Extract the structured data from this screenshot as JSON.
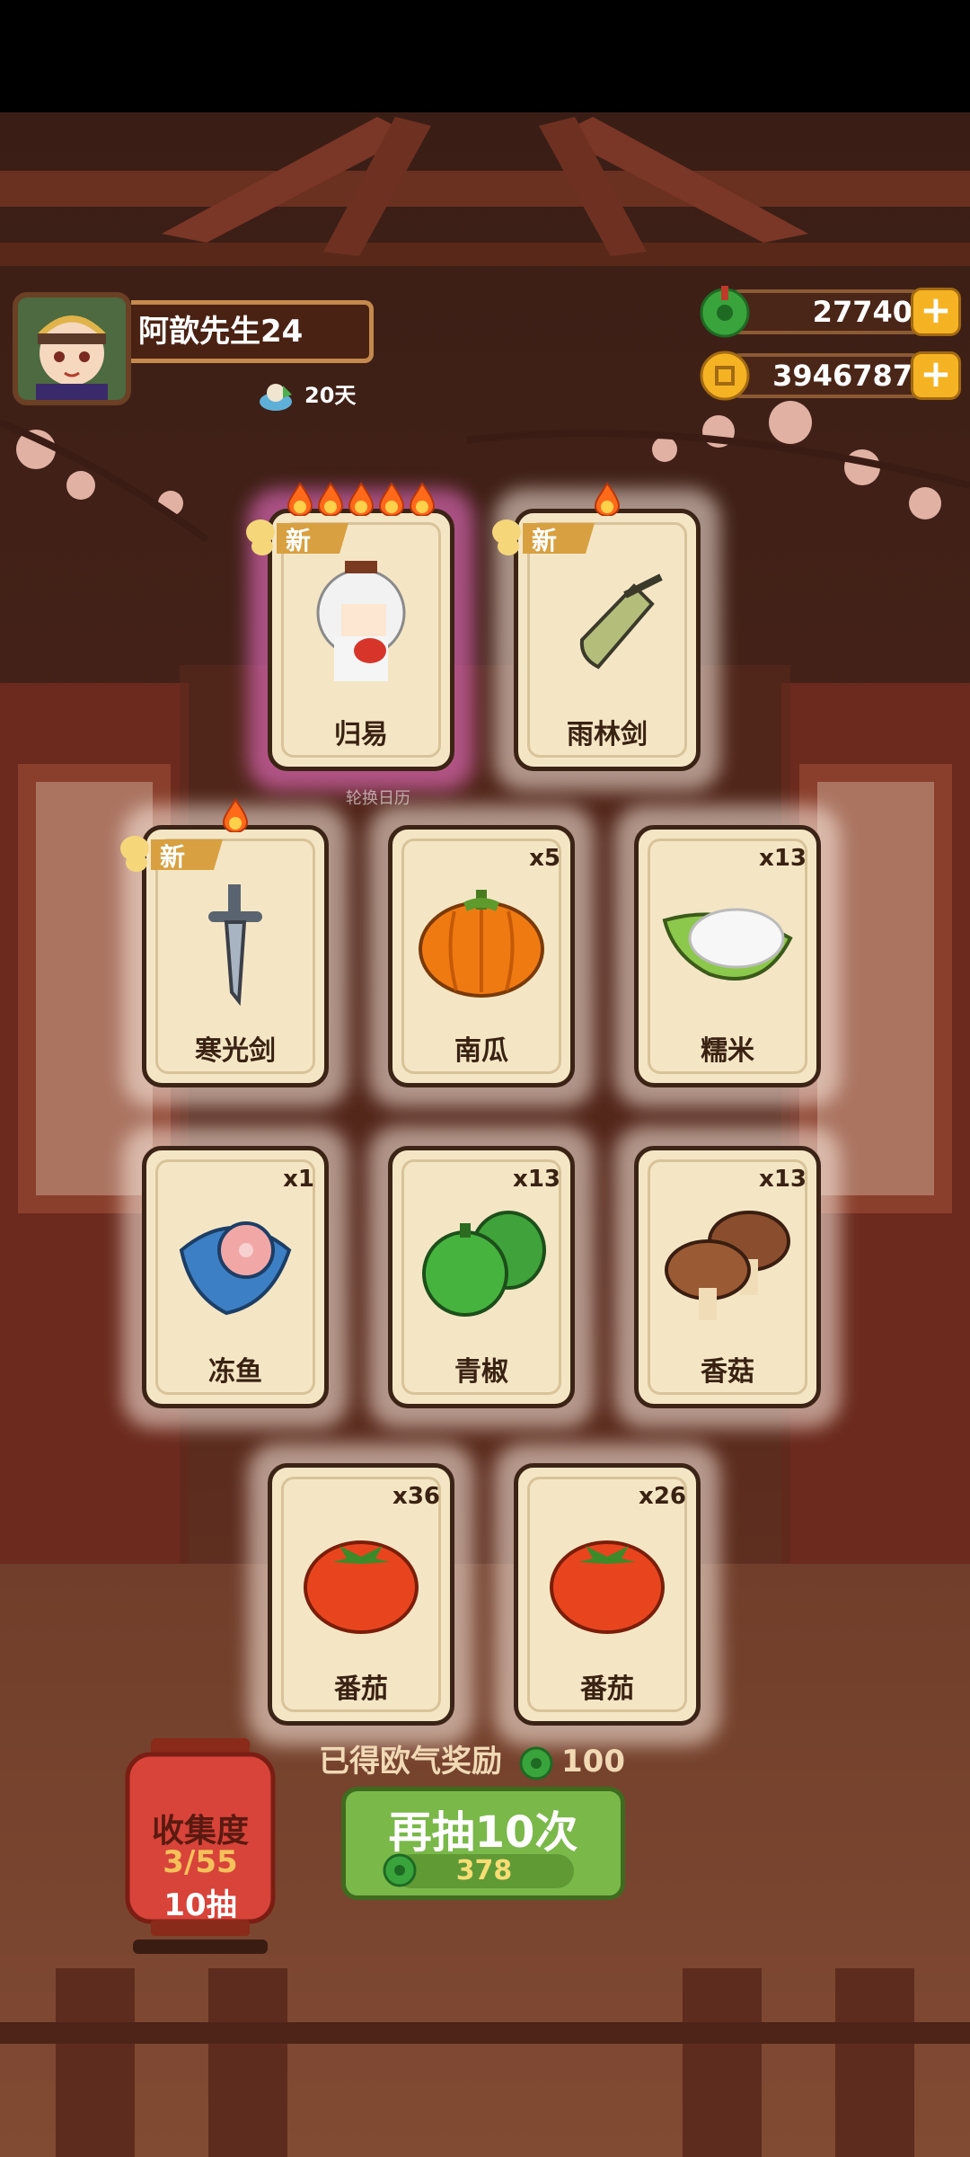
{
  "player": {
    "name": "阿歆先生24",
    "days": "20天"
  },
  "currency": {
    "jade": "27740",
    "coins": "3946787",
    "plus": "+"
  },
  "watermark": "轮换日历",
  "cards_row1": [
    {
      "name": "归易",
      "new_label": "新",
      "flames": 5,
      "rare": true
    },
    {
      "name": "雨林剑",
      "new_label": "新",
      "flames": 1,
      "rare": false
    }
  ],
  "cards_row2": [
    {
      "name": "寒光剑",
      "new_label": "新",
      "flames": 1
    },
    {
      "name": "南瓜",
      "count": "x5"
    },
    {
      "name": "糯米",
      "count": "x13"
    }
  ],
  "cards_row3": [
    {
      "name": "冻鱼",
      "count": "x1"
    },
    {
      "name": "青椒",
      "count": "x13"
    },
    {
      "name": "香菇",
      "count": "x13"
    }
  ],
  "cards_row4": [
    {
      "name": "番茄",
      "count": "x36"
    },
    {
      "name": "番茄",
      "count": "x26"
    }
  ],
  "reward": {
    "label": "已得欧气奖励",
    "value": "100"
  },
  "collection": {
    "title": "收集度",
    "progress": "3/55",
    "draws": "10抽"
  },
  "draw_button": {
    "label": "再抽10次",
    "cost": "378"
  },
  "colors": {
    "jade": "#3aa43c",
    "coin": "#f5b324",
    "button": "#7ab84a",
    "card": "#f4e6c5"
  }
}
